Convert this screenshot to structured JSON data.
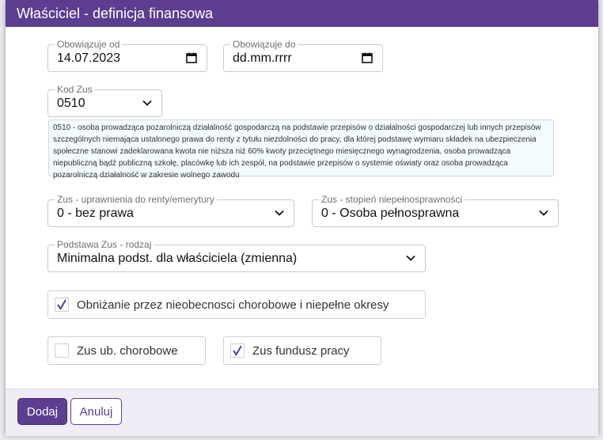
{
  "dialog": {
    "title": "Właściciel - definicja finansowa"
  },
  "valid_from": {
    "label": "Obowiązuje od",
    "value": "14.07.2023"
  },
  "valid_to": {
    "label": "Obowiązuje do",
    "value": "dd.mm.rrrr"
  },
  "zus_code": {
    "label": "Kod Zus",
    "value": "0510",
    "description": "0510 - osoba prowadząca pozarolniczą działalność gospodarczą na podstawie przepisów o działalności gospodarczej lub innych przepisów szczególnych niemająca ustalonego prawa do renty z tytułu niezdolności do pracy, dla której podstawę wymiaru składek na ubezpieczenia społeczne stanowi zadeklarowana kwota nie niższa niż 60% kwoty przeciętnego miesięcznego wynagrodzenia, osoba prowadząca niepubliczną bądź publiczną szkołę, placówkę lub ich zespół, na podstawie przepisów o systemie oświaty oraz osoba prowadząca pozarolniczą działalność w zakresie wolnego zawodu"
  },
  "pension_rights": {
    "label": "Zus - uprawnienia do renty/emerytury",
    "value": "0 - bez prawa"
  },
  "disability": {
    "label": "Zus - stopień niepełnosprawności",
    "value": "0 - Osoba pełnosprawna"
  },
  "zus_basis": {
    "label": "Podstawa Zus - rodzaj",
    "value": "Minimalna podst. dla właściciela (zmienna)"
  },
  "checkboxes": {
    "reduce": {
      "label": "Obniżanie przez nieobecnosci chorobowe i niepełne okresy",
      "checked": true
    },
    "sickness": {
      "label": "Zus ub. chorobowe",
      "checked": false
    },
    "labor_fund": {
      "label": "Zus fundusz pracy",
      "checked": true
    }
  },
  "footer": {
    "add_label": "Dodaj",
    "cancel_label": "Anuluj"
  },
  "colors": {
    "accent": "#5c3d8f",
    "footer_bg": "#efecf5",
    "desc_bg": "#f4fbfc"
  }
}
